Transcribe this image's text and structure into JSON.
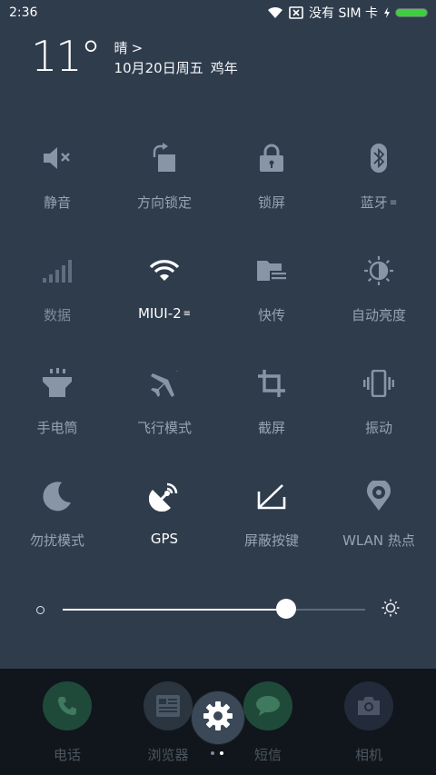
{
  "status_bar": {
    "time": "2:36",
    "no_sim_text": "没有 SIM 卡",
    "icons": [
      "wifi-icon",
      "no-sim-icon",
      "charging-icon",
      "battery-icon"
    ],
    "battery_color": "#3ecf3e"
  },
  "weather": {
    "temperature": "11°",
    "condition": "晴",
    "arrow": ">",
    "date": "10月20日周五",
    "zodiac_year": "鸡年"
  },
  "tiles": [
    {
      "label": "静音",
      "icon": "mute-icon",
      "active": false
    },
    {
      "label": "方向锁定",
      "icon": "rotation-lock-icon",
      "active": false
    },
    {
      "label": "锁屏",
      "icon": "lock-icon",
      "active": false
    },
    {
      "label": "蓝牙",
      "icon": "bluetooth-icon",
      "active": false,
      "more": "≡"
    },
    {
      "label": "数据",
      "icon": "signal-icon",
      "active": false
    },
    {
      "label": "MIUI-2",
      "icon": "wifi-icon",
      "active": true,
      "more": "≡"
    },
    {
      "label": "快传",
      "icon": "folder-transfer-icon",
      "active": false
    },
    {
      "label": "自动亮度",
      "icon": "auto-brightness-icon",
      "active": false
    },
    {
      "label": "手电筒",
      "icon": "flashlight-icon",
      "active": false
    },
    {
      "label": "飞行模式",
      "icon": "airplane-icon",
      "active": false
    },
    {
      "label": "截屏",
      "icon": "crop-icon",
      "active": false
    },
    {
      "label": "振动",
      "icon": "vibrate-icon",
      "active": false
    },
    {
      "label": "勿扰模式",
      "icon": "moon-icon",
      "active": false
    },
    {
      "label": "GPS",
      "icon": "gps-icon",
      "active": true
    },
    {
      "label": "屏蔽按键",
      "icon": "block-keys-icon",
      "active": false
    },
    {
      "label": "WLAN 热点",
      "icon": "hotspot-icon",
      "active": false
    }
  ],
  "brightness": {
    "level": 0.74
  },
  "dock": {
    "apps": [
      {
        "label": "电话",
        "icon": "phone-icon",
        "color": "#1f4a3a"
      },
      {
        "label": "浏览器",
        "icon": "browser-icon",
        "color": "#2a3540"
      },
      {
        "label": "短信",
        "icon": "message-icon",
        "color": "#1f4a3a"
      },
      {
        "label": "相机",
        "icon": "camera-icon",
        "color": "#232b3a"
      }
    ]
  },
  "colors": {
    "panel_bg": "#2f3c4c",
    "dock_bg": "#10161c",
    "icon_off": "#8795a6",
    "icon_on": "#ffffff"
  }
}
